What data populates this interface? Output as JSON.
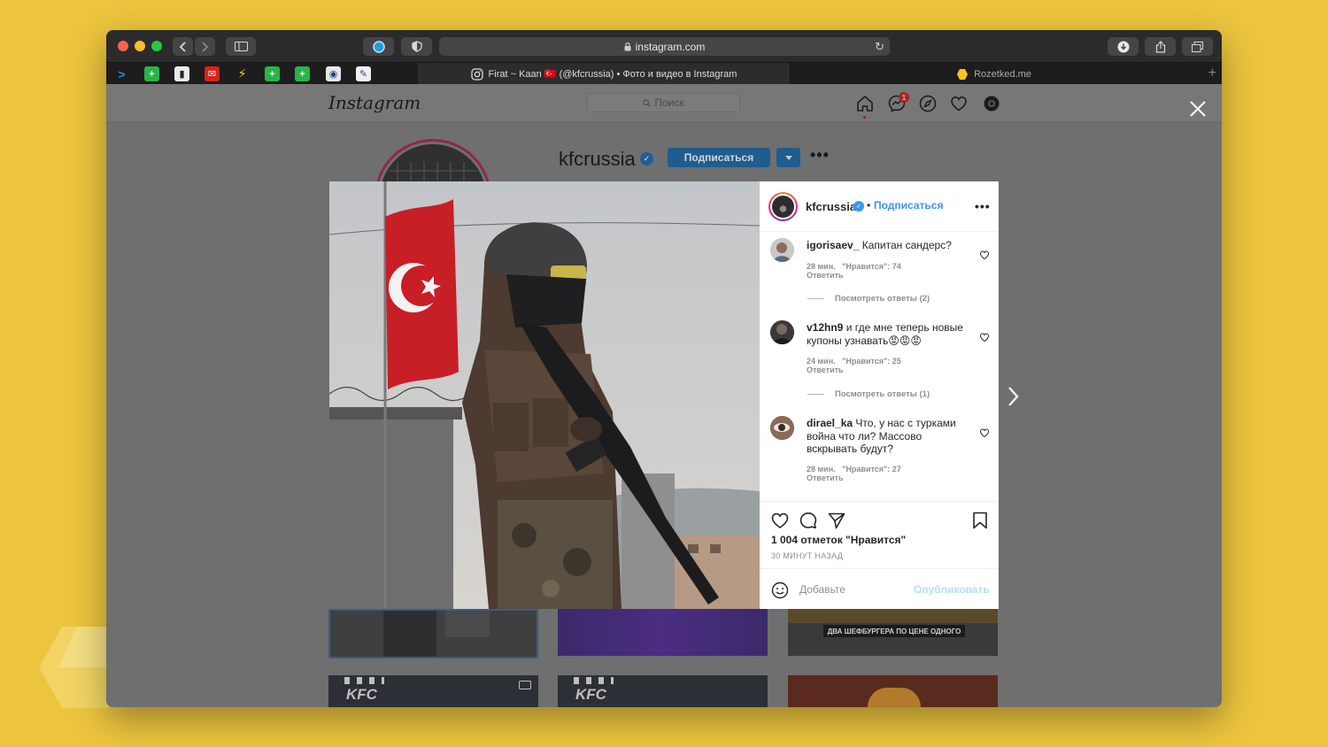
{
  "browser": {
    "url": "instagram.com",
    "active_tab_title": "Firat ~ Kaan 🇹🇷 (@kfcrussia) • Фото и видео в Instagram",
    "other_tab_title": "Rozetked.me"
  },
  "instagram": {
    "logo": "Instagram",
    "search_placeholder": "Поиск",
    "notification_count": "1"
  },
  "profile": {
    "username": "kfcrussia",
    "follow_label": "Подписаться",
    "more_label": "•••"
  },
  "post": {
    "username": "kfcrussia",
    "follow_label": "Подписаться",
    "more_label": "•••",
    "comments": [
      {
        "user": "igorisaev_",
        "text": "Капитан сандерс?",
        "time": "28 мин.",
        "likes": "\"Нравится\": 74",
        "reply_label": "Ответить",
        "view_replies": "Посмотреть ответы (2)"
      },
      {
        "user": "v12hn9",
        "text": "и где мне теперь новые купоны узнавать😡😡😡",
        "time": "24 мин.",
        "likes": "\"Нравится\": 25",
        "reply_label": "Ответить",
        "view_replies": "Посмотреть ответы (1)"
      },
      {
        "user": "dirael_ka",
        "text": "Что, у нас с турками война что ли? Массово вскрывать будут?",
        "time": "28 мин.",
        "likes": "\"Нравится\": 27",
        "reply_label": "Ответить"
      }
    ],
    "likes_count": "1 004 отметок \"Нравится\"",
    "time_ago": "30 МИНУТ НАЗАД",
    "add_comment_placeholder": "Добавьте",
    "publish_label": "Опубликовать"
  },
  "grid": {
    "promo_text": "ДВА ШЕФБУРГЕРА ПО ЦЕНЕ ОДНОГО",
    "brand": "KFC"
  },
  "colors": {
    "instagram_blue": "#3897f0",
    "follow_button_dimmed": "#1f5d90",
    "overlay": "#6f6f6f",
    "background": "#ecc43e"
  }
}
